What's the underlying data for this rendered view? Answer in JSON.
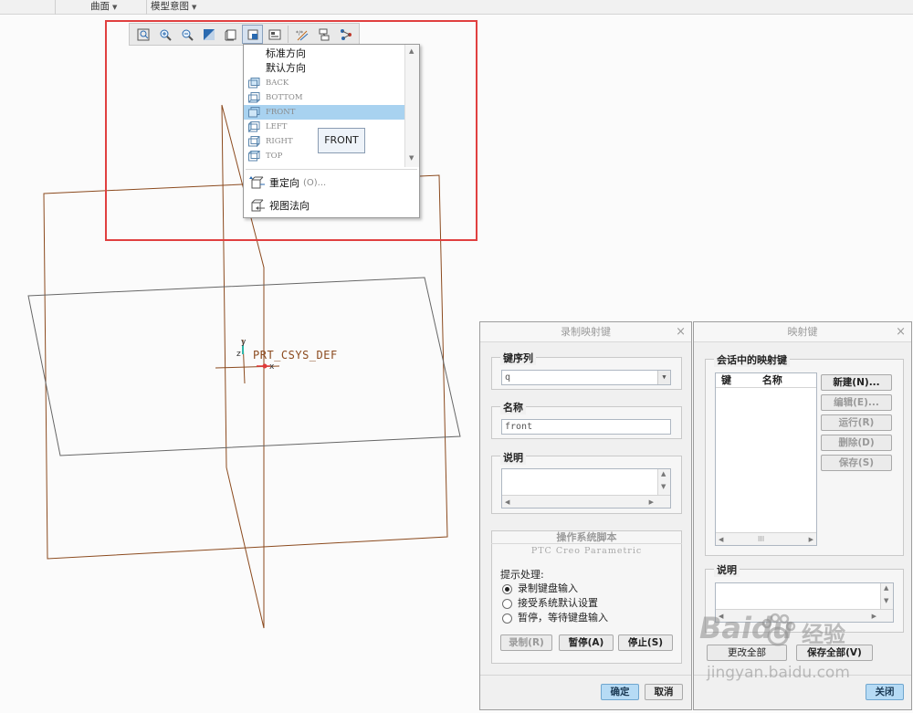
{
  "ribbon": {
    "groups": [
      {
        "label": "曲面"
      },
      {
        "label": "模型意图"
      }
    ]
  },
  "viewport": {
    "csys_label": "PRT_CSYS_DEF",
    "axis_x": "x",
    "axis_y": "y",
    "axis_z": "z",
    "colors": {
      "datum_plane": "#8b4a1e",
      "plane_edge": "#666666",
      "csys_y": "#2fb6a8",
      "csys_x": "#e03a3a"
    }
  },
  "view_toolbar": {
    "buttons": [
      {
        "icon": "refit-icon"
      },
      {
        "icon": "zoom-in-icon"
      },
      {
        "icon": "zoom-out-icon"
      },
      {
        "icon": "repaint-icon"
      },
      {
        "icon": "display-style-icon"
      },
      {
        "icon": "saved-orientations-icon"
      },
      {
        "icon": "view-manager-icon"
      },
      {
        "icon": "datum-display-icon"
      },
      {
        "icon": "annotation-display-icon"
      },
      {
        "icon": "spin-center-icon"
      }
    ]
  },
  "orientation_menu": {
    "items": [
      {
        "label": "标准方向",
        "kind": "plain"
      },
      {
        "label": "默认方向",
        "kind": "plain"
      },
      {
        "label": "BACK",
        "kind": "view"
      },
      {
        "label": "BOTTOM",
        "kind": "view"
      },
      {
        "label": "FRONT",
        "kind": "view",
        "selected": true
      },
      {
        "label": "LEFT",
        "kind": "view"
      },
      {
        "label": "RIGHT",
        "kind": "view"
      },
      {
        "label": "TOP",
        "kind": "view"
      }
    ],
    "reorient_label": "重定向",
    "reorient_hint": "(O)...",
    "normal_view_label": "视图法向",
    "tooltip": "FRONT"
  },
  "record_dialog": {
    "title": "录制映射键",
    "close": "×",
    "key_sequence_label": "键序列",
    "key_sequence_value": "q",
    "name_label": "名称",
    "name_value": "front",
    "description_label": "说明",
    "os_script_title": "操作系统脚本",
    "app_name": "PTC Creo Parametric",
    "prompt_label": "提示处理:",
    "prompt_options": [
      {
        "label": "录制键盘输入",
        "checked": true
      },
      {
        "label": "接受系统默认设置",
        "checked": false
      },
      {
        "label": "暂停，等待键盘输入",
        "checked": false
      }
    ],
    "record_button": "录制(R)",
    "pause_button": "暂停(A)",
    "stop_button": "停止(S)",
    "ok_button": "确定",
    "cancel_button": "取消"
  },
  "mapkeys_dialog": {
    "title": "映射键",
    "close": "×",
    "session_group_label": "会话中的映射键",
    "col_key": "键",
    "col_name": "名称",
    "hscroll_label": "III",
    "new_button": "新建(N)...",
    "edit_button": "编辑(E)...",
    "run_button": "运行(R)",
    "delete_button": "删除(D)",
    "save_button": "保存(S)",
    "description_label": "说明",
    "bottom_left_button": "更改全部",
    "bottom_right_button": "保存全部(V)",
    "close_button": "关闭"
  },
  "watermark": {
    "brand": "Baidu",
    "brand_cn": "经验",
    "url": "jingyan.baidu.com"
  }
}
